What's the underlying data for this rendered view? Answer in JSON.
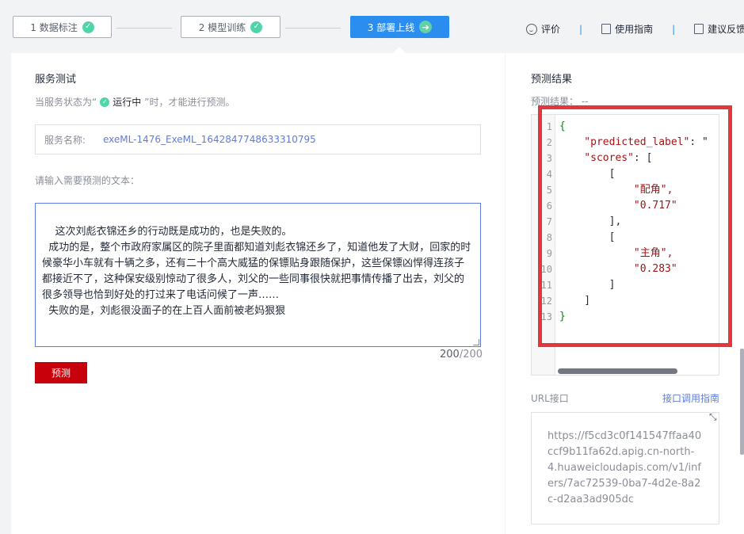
{
  "steps": [
    {
      "label": "1 数据标注",
      "status": "done"
    },
    {
      "label": "2 模型训练",
      "status": "done"
    },
    {
      "label": "3 部署上线",
      "status": "active"
    }
  ],
  "toplinks": {
    "rate": "评价",
    "guide": "使用指南",
    "feedback": "建议反馈"
  },
  "service_test": {
    "title": "服务测试",
    "hint_prefix": "当服务状态为“",
    "hint_status": "运行中",
    "hint_suffix": "”时，才能进行预测。",
    "service_name_label": "服务名称:",
    "service_name_value": "exeML-1476_ExeML_1642847748633310795",
    "input_label": "请输入需要预测的文本：",
    "input_text": "  这次刘彪衣锦还乡的行动既是成功的，也是失败的。\n  成功的是，整个市政府家属区的院子里面都知道刘彪衣锦还乡了，知道他发了大财，回家的时候豪华小车就有十辆之多，还有二十个高大威猛的保镖贴身跟随保护，这些保镖凶悍得连孩子都接近不了，这种保安级别惊动了很多人，刘父的一些同事很快就把事情传播了出去，刘父的很多领导也恰到好处的打过来了电话问候了一声……\n  失败的是，刘彪很没面子的在上百人面前被老妈狠狠",
    "char_count": "200",
    "char_max": "/200",
    "predict_button": "预测"
  },
  "result": {
    "title": "预测结果",
    "result_label": "预测结果：  --",
    "code_lines": [
      {
        "n": "1",
        "text": "{"
      },
      {
        "n": "2",
        "text": "    \"predicted_label\": \""
      },
      {
        "n": "3",
        "text": "    \"scores\": ["
      },
      {
        "n": "4",
        "text": "        ["
      },
      {
        "n": "5",
        "text": "            \"配角\","
      },
      {
        "n": "6",
        "text": "            \"0.717\""
      },
      {
        "n": "7",
        "text": "        ],"
      },
      {
        "n": "8",
        "text": "        ["
      },
      {
        "n": "9",
        "text": "            \"主角\","
      },
      {
        "n": "10",
        "text": "            \"0.283\""
      },
      {
        "n": "11",
        "text": "        ]"
      },
      {
        "n": "12",
        "text": "    ]"
      },
      {
        "n": "13",
        "text": "}"
      }
    ],
    "url_title": "URL接口",
    "url_link": "接口调用指南",
    "url_value": "https://f5cd3c0f141547ffaa40ccf9b11fa62d.apig.cn-north-4.huaweicloudapis.com/v1/infers/7ac72539-0ba7-4d2e-8a2c-d2aa3ad905dc"
  },
  "colors": {
    "accent": "#2a8df0",
    "check": "#50d4ab",
    "danger": "#c7000b",
    "highlight": "#e5363d",
    "link": "#5e7ce0"
  }
}
